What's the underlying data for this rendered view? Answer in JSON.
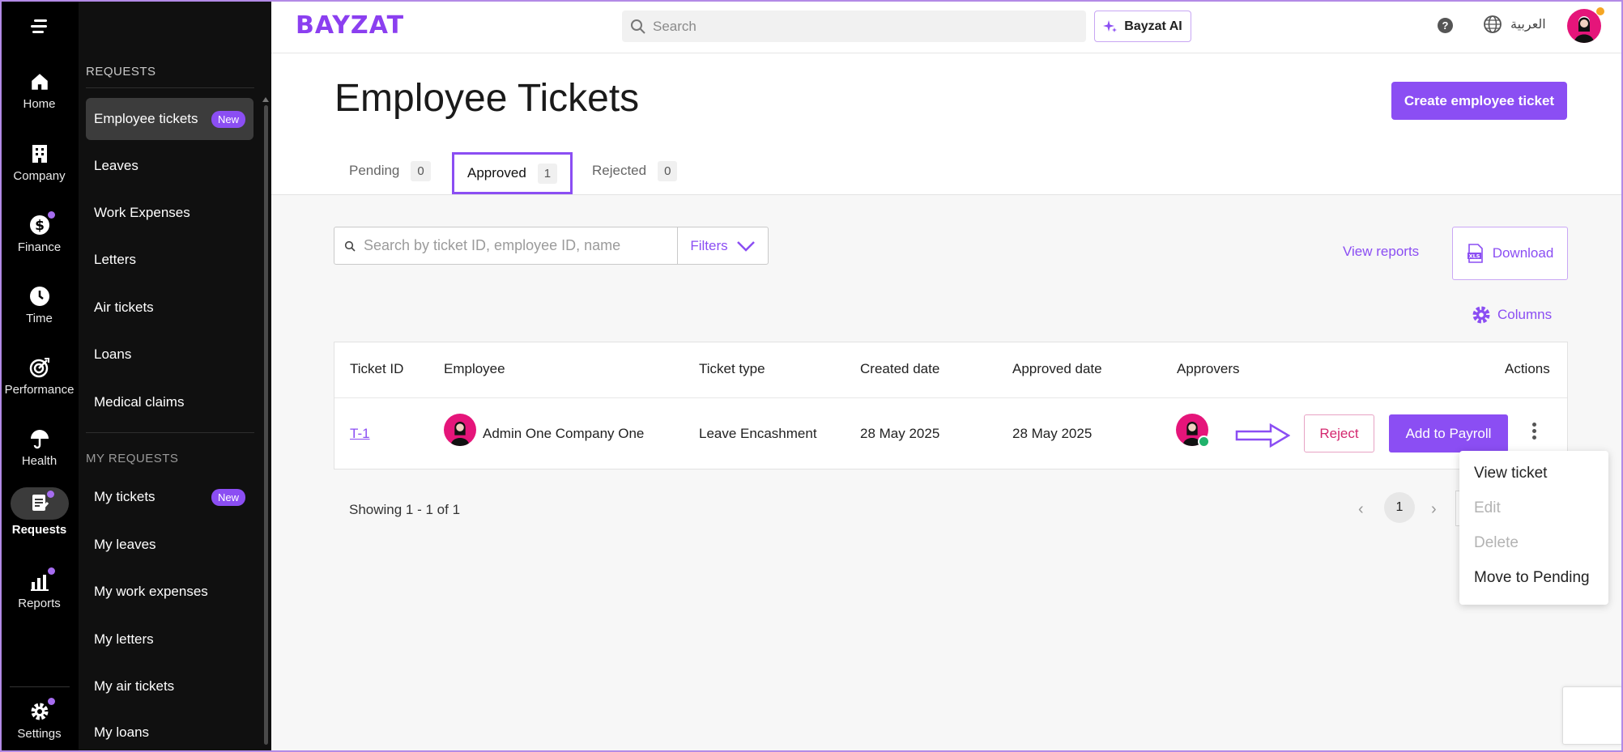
{
  "rail": {
    "items": [
      {
        "label": "Home",
        "icon": "home-icon"
      },
      {
        "label": "Company",
        "icon": "building-icon"
      },
      {
        "label": "Finance",
        "icon": "dollar-icon"
      },
      {
        "label": "Time",
        "icon": "clock-icon"
      },
      {
        "label": "Performance",
        "icon": "target-icon"
      },
      {
        "label": "Health",
        "icon": "umbrella-icon"
      },
      {
        "label": "Requests",
        "icon": "requests-icon"
      },
      {
        "label": "Reports",
        "icon": "chart-icon"
      },
      {
        "label": "Settings",
        "icon": "gear-icon"
      }
    ]
  },
  "sidebar": {
    "requests_heading": "REQUESTS",
    "my_requests_heading": "MY REQUESTS",
    "badge_new": "New",
    "requests": [
      {
        "label": "Employee tickets"
      },
      {
        "label": "Leaves"
      },
      {
        "label": "Work Expenses"
      },
      {
        "label": "Letters"
      },
      {
        "label": "Air tickets"
      },
      {
        "label": "Loans"
      },
      {
        "label": "Medical claims"
      }
    ],
    "my_requests": [
      {
        "label": "My tickets"
      },
      {
        "label": "My leaves"
      },
      {
        "label": "My work expenses"
      },
      {
        "label": "My letters"
      },
      {
        "label": "My air tickets"
      },
      {
        "label": "My loans"
      }
    ]
  },
  "topbar": {
    "logo": "BAYZAT",
    "search_placeholder": "Search",
    "ai_label": "Bayzat AI",
    "help": "?",
    "language": "العربية"
  },
  "page": {
    "title": "Employee Tickets",
    "create_label": "Create employee ticket",
    "tabs": [
      {
        "label": "Pending",
        "count": "0"
      },
      {
        "label": "Approved",
        "count": "1"
      },
      {
        "label": "Rejected",
        "count": "0"
      }
    ],
    "search_placeholder": "Search by ticket ID, employee ID, name",
    "filters_label": "Filters",
    "view_reports_label": "View reports",
    "download_label": "Download",
    "xls_label": "XLS",
    "columns_label": "Columns"
  },
  "table": {
    "headers": [
      "Ticket ID",
      "Employee",
      "Ticket type",
      "Created date",
      "Approved date",
      "Approvers",
      "Actions"
    ],
    "row": {
      "ticket_id": "T-1",
      "employee": "Admin One Company One",
      "ticket_type": "Leave Encashment",
      "created_date": "28 May 2025",
      "approved_date": "28 May 2025",
      "reject_label": "Reject",
      "payroll_label": "Add to Payroll"
    }
  },
  "pagination": {
    "showing": "Showing 1 - 1 of 1",
    "prev": "‹",
    "current": "1",
    "next": "›"
  },
  "dropdown": {
    "items": [
      {
        "label": "View ticket"
      },
      {
        "label": "Edit"
      },
      {
        "label": "Delete"
      },
      {
        "label": "Move to Pending"
      }
    ]
  },
  "colors": {
    "accent": "#8b4ef3",
    "reject": "#d4286f",
    "avatar": "#e5157a"
  }
}
